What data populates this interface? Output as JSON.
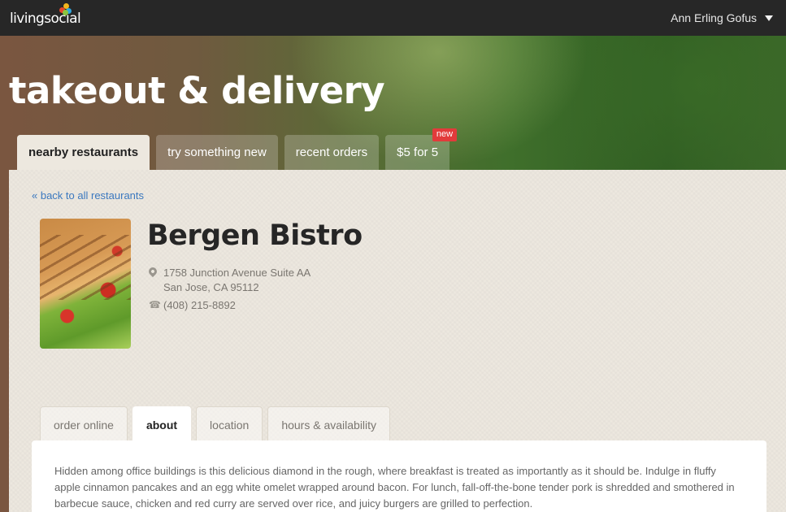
{
  "header": {
    "logo_text": "livingsocial",
    "user_name": "Ann Erling Gofus",
    "colors": {
      "bar": "#272727"
    }
  },
  "hero": {
    "title": "takeout & delivery",
    "tabs": [
      {
        "label": "nearby restaurants",
        "active": true
      },
      {
        "label": "try something new",
        "active": false
      },
      {
        "label": "recent orders",
        "active": false
      },
      {
        "label": "$5 for 5",
        "active": false,
        "badge": "new"
      }
    ]
  },
  "restaurant": {
    "back_link": "« back to all restaurants",
    "name": "Bergen Bistro",
    "address_line1": "1758 Junction Avenue Suite AA",
    "address_line2": "San Jose, CA 95112",
    "phone": "(408) 215-8892",
    "image_icon": "food-photo"
  },
  "subtabs": [
    {
      "label": "order online",
      "active": false
    },
    {
      "label": "about",
      "active": true
    },
    {
      "label": "location",
      "active": false
    },
    {
      "label": "hours & availability",
      "active": false
    }
  ],
  "about_text": "Hidden among office buildings is this delicious diamond in the rough, where breakfast is treated as importantly as it should be. Indulge in fluffy apple cinnamon pancakes and an egg white omelet wrapped around bacon. For lunch, fall-off-the-bone tender pork is shredded and smothered in barbecue sauce, chicken and red curry are served over rice, and juicy burgers are grilled to perfection.",
  "colors": {
    "link": "#3b78bf",
    "badge": "#e23b3b"
  }
}
